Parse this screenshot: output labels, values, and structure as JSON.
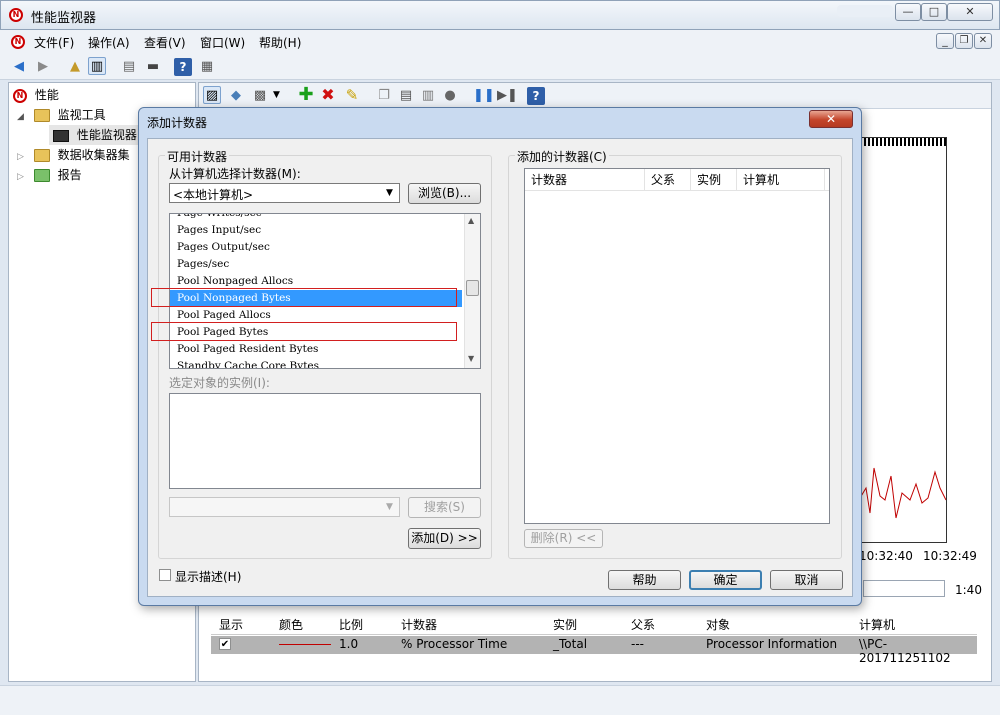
{
  "window": {
    "title": "性能监视器",
    "min_label": "—",
    "max_label": "□",
    "close_label": "✕",
    "inner_min": "_",
    "inner_restore": "❐",
    "inner_close": "✕"
  },
  "menu": [
    "文件(F)",
    "操作(A)",
    "查看(V)",
    "窗口(W)",
    "帮助(H)"
  ],
  "tree": {
    "root": "性能",
    "monitor_tools": "监视工具",
    "perf_monitor": "性能监视器",
    "data_collector": "数据收集器集",
    "reports": "报告"
  },
  "graph": {
    "times": [
      "10:32:40",
      "10:32:49"
    ],
    "duration": "1:40",
    "line_color": "#c00000"
  },
  "counter_table": {
    "headers": [
      "显示",
      "颜色",
      "比例",
      "计数器",
      "实例",
      "父系",
      "对象",
      "计算机"
    ],
    "row": {
      "checked": "✔",
      "scale": "1.0",
      "counter": "% Processor Time",
      "instance": "_Total",
      "parent": "---",
      "object": "Processor Information",
      "computer": "\\\\PC-201711251102"
    }
  },
  "dialog": {
    "title": "添加计数器",
    "close": "✕",
    "available_group": "可用计数器",
    "select_from_label": "从计算机选择计数器(M):",
    "computer_value": "<本地计算机>",
    "browse_button": "浏览(B)...",
    "counters": [
      "Page Writes/sec",
      "Pages Input/sec",
      "Pages Output/sec",
      "Pages/sec",
      "Pool Nonpaged Allocs",
      "Pool Nonpaged Bytes",
      "Pool Paged Allocs",
      "Pool Paged Bytes",
      "Pool Paged Resident Bytes",
      "Standby Cache Core Bytes"
    ],
    "instances_label": "选定对象的实例(I):",
    "search_button": "搜索(S)",
    "add_button": "添加(D) >>",
    "added_group": "添加的计数器(C)",
    "added_headers": [
      "计数器",
      "父系",
      "实例",
      "计算机"
    ],
    "remove_button": "删除(R) <<",
    "show_desc_label": "显示描述(H)",
    "help_button": "帮助",
    "ok_button": "确定",
    "cancel_button": "取消"
  }
}
